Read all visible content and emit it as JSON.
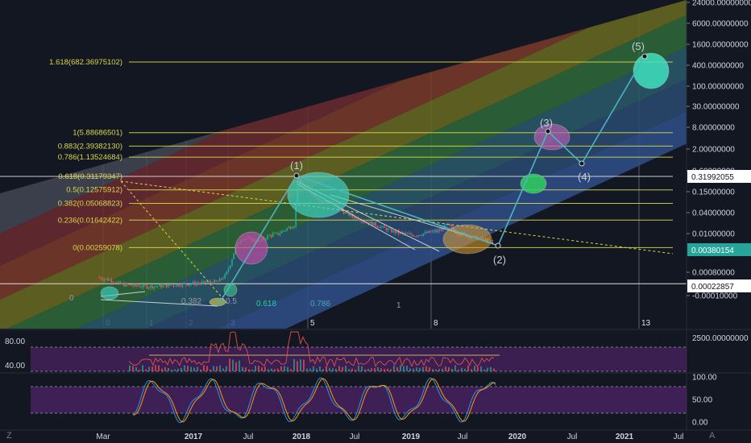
{
  "chart_data": [
    {
      "type": "candlestick",
      "scale": "log",
      "x_ticks": [
        "Mar",
        "2017",
        "Jul",
        "2018",
        "Jul",
        "2019",
        "Jul",
        "2020",
        "Jul",
        "2021",
        "Jul"
      ],
      "y_ticks": [
        "24000.00000000",
        "6000.00000000",
        "1600.00000000",
        "400.00000000",
        "100.00000000",
        "30.00000000",
        "8.00000000",
        "2.00000000",
        "0.60000000",
        "0.15000000",
        "0.04000000",
        "0.01000000",
        "0.00080000",
        "-0.00010000"
      ],
      "price_labels": [
        {
          "text": "0.31992055",
          "color": "#ffffff"
        },
        {
          "text": "0.00380154",
          "color": "#26a69a"
        },
        {
          "text": "0.00022857",
          "color": "#ffffff"
        }
      ],
      "fib_levels": [
        {
          "label": "1.618(682.36975102)",
          "value": 682.36975102
        },
        {
          "label": "1(5.88686501)",
          "value": 5.88686501
        },
        {
          "label": "0.883(2.39382130)",
          "value": 2.3938213
        },
        {
          "label": "0.786(1.13524684)",
          "value": 1.13524684
        },
        {
          "label": "0.618(0.31179347)",
          "value": 0.31179347
        },
        {
          "label": "0.5(0.12575912)",
          "value": 0.12575912
        },
        {
          "label": "0.382(0.05068823)",
          "value": 0.05068823
        },
        {
          "label": "0.236(0.01642422)",
          "value": 0.01642422
        },
        {
          "label": "0(0.00259078)",
          "value": 0.00259078
        }
      ],
      "wave_labels": [
        "(1)",
        "(2)",
        "(3)",
        "(4)",
        "(5)"
      ],
      "fib_time_labels": [
        "0",
        "1",
        "2",
        "3",
        "5",
        "8",
        "13"
      ],
      "channel_labels": [
        "0",
        "0.382",
        "0.5",
        "0.618",
        "0.786",
        "1"
      ],
      "colors": {
        "bull": "#26a69a",
        "bear": "#ef5350",
        "fib": "#d8d84b",
        "wave": "#4fb3bf"
      }
    },
    {
      "type": "line",
      "y_ticks_left": [
        "80.00",
        "40.00"
      ],
      "y_ticks_right": [
        "2500.00000000"
      ]
    },
    {
      "type": "line",
      "y_ticks": [
        "100.00",
        "50.00",
        "0.00"
      ]
    }
  ],
  "footer": {
    "left_icon": "Z",
    "right_icon": "A"
  }
}
